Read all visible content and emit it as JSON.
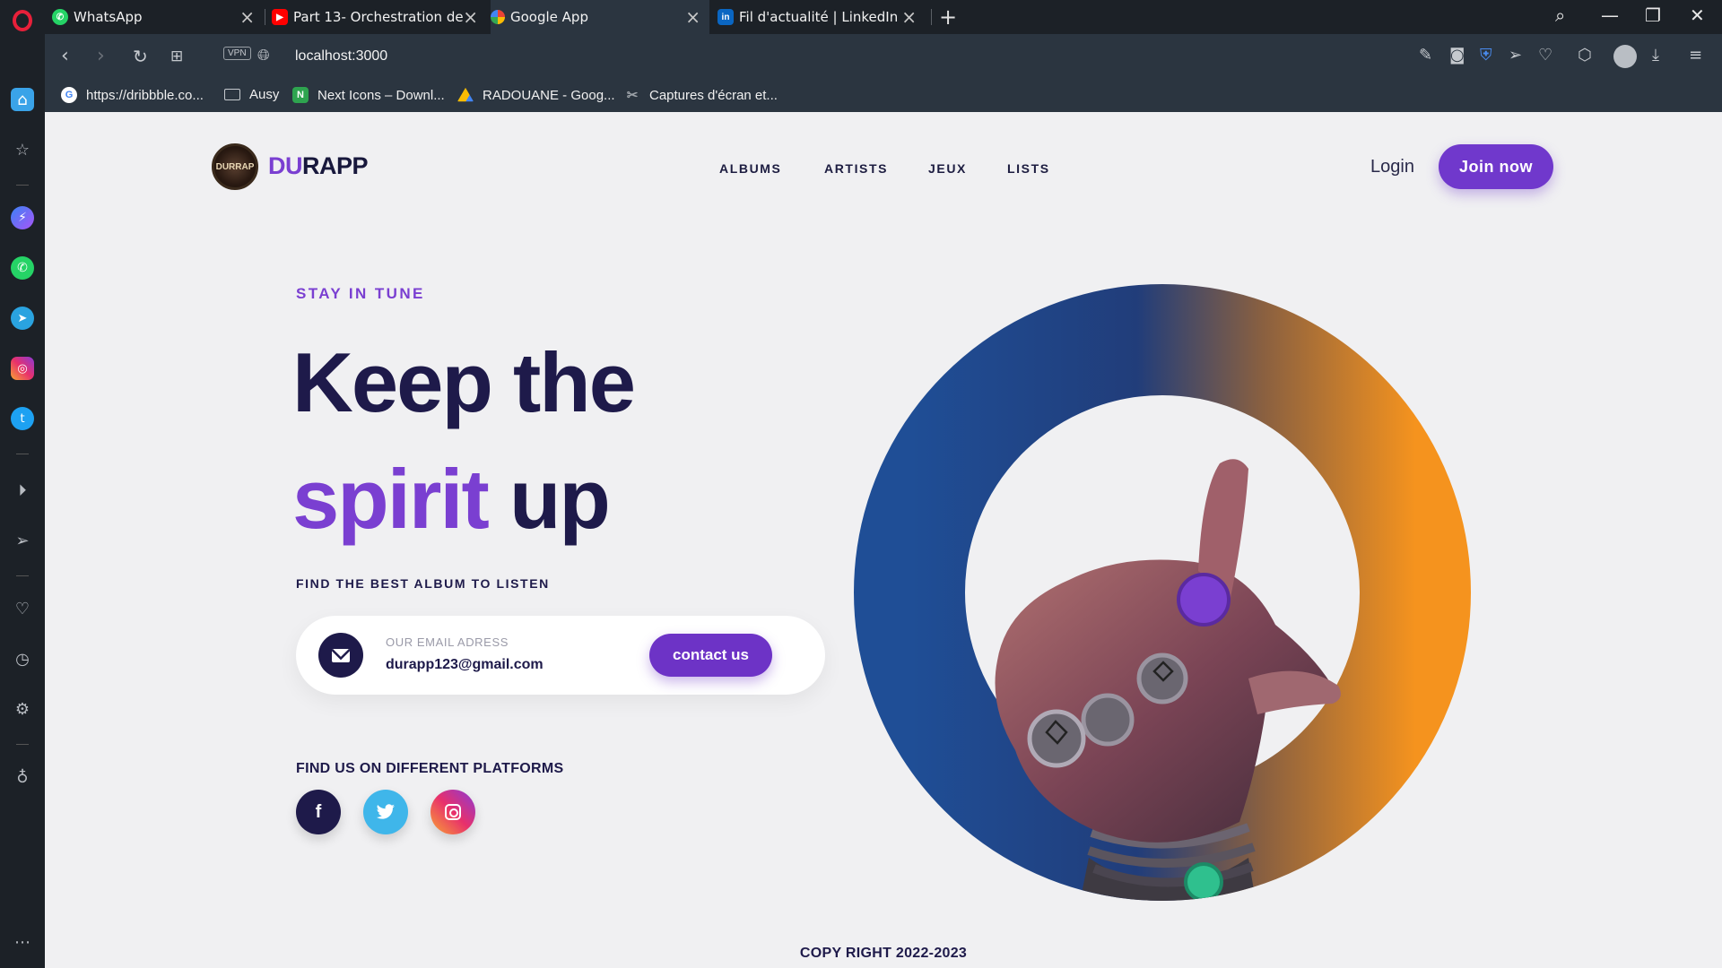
{
  "browser": {
    "tabs": [
      {
        "title": "WhatsApp",
        "icon": "whatsapp-icon",
        "color": "#25d366"
      },
      {
        "title": "Part 13- Orchestration des",
        "icon": "youtube-icon",
        "color": "#ff0000"
      },
      {
        "title": "Google App",
        "icon": "google-icon",
        "color": "#4285f4",
        "active": true
      },
      {
        "title": "Fil d'actualité | LinkedIn",
        "icon": "linkedin-icon",
        "color": "#0a66c2"
      }
    ],
    "vpn_label": "VPN",
    "url": "localhost:3000",
    "bookmarks": [
      {
        "label": "https://dribbble.co...",
        "icon": "google-icon",
        "color": "#ffffff"
      },
      {
        "label": "Ausy",
        "icon": "folder-icon",
        "color": "#c5c9ce"
      },
      {
        "label": "Next Icons – Downl...",
        "icon": "next-icons-icon",
        "color": "#2ea44f"
      },
      {
        "label": "RADOUANE - Goog...",
        "icon": "google-drive-icon",
        "color": "#fbbc04"
      },
      {
        "label": "Captures d'écran et...",
        "icon": "screenshot-icon",
        "color": "#9aa0a6"
      }
    ]
  },
  "site": {
    "brand": {
      "prefix": "DU",
      "suffix": "RAPP",
      "logo_text": "DURRAP"
    },
    "nav": [
      "ALBUMS",
      "ARTISTS",
      "JEUX",
      "LISTS"
    ],
    "login": "Login",
    "join": "Join now",
    "hero": {
      "eyebrow": "STAY IN TUNE",
      "line1": "Keep the",
      "line2_accent": "spirit",
      "line2_rest": "up",
      "subhead": "FIND THE BEST ALBUM TO LISTEN"
    },
    "email": {
      "label": "OUR EMAIL ADRESS",
      "value": "durapp123@gmail.com",
      "button": "contact us"
    },
    "platforms_title": "FIND US ON DIFFERENT PLATFORMS",
    "socials": [
      {
        "name": "facebook",
        "icon": "facebook-icon",
        "glyph": "f"
      },
      {
        "name": "twitter",
        "icon": "twitter-icon",
        "glyph": "t"
      },
      {
        "name": "instagram",
        "icon": "instagram-icon",
        "glyph": ""
      }
    ],
    "copyright": "COPY RIGHT 2022-2023",
    "colors": {
      "accent": "#7a3fd1",
      "navy": "#1e1a4a",
      "ring_start": "#1f4e96",
      "ring_end": "#f5931e"
    }
  }
}
